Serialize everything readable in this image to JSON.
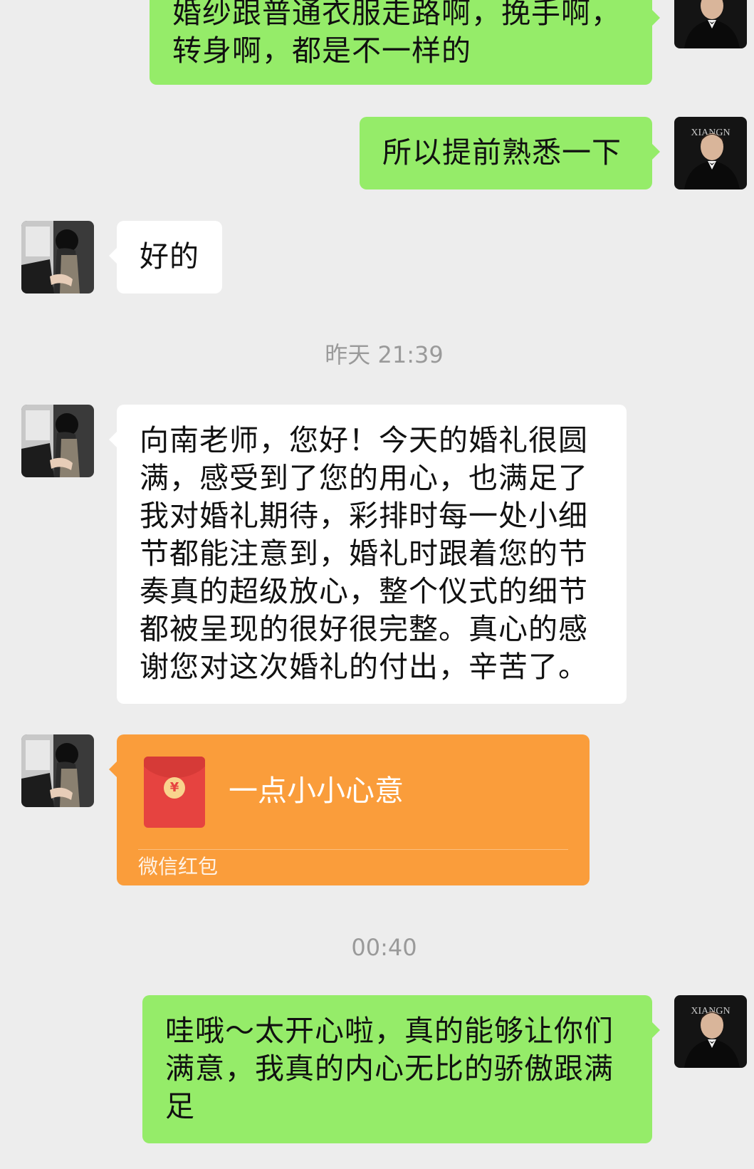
{
  "messages": [
    {
      "sender": "self",
      "text": "婚纱跟普通衣服走路啊，挽手啊，转身啊，都是不一样的"
    },
    {
      "sender": "self",
      "text": "所以提前熟悉一下"
    },
    {
      "sender": "other",
      "text": "好的"
    },
    {
      "sender": "other",
      "text": "向南老师，您好！今天的婚礼很圆满，感受到了您的用心，也满足了我对婚礼期待，彩排时每一处小细节都能注意到，婚礼时跟着您的节奏真的超级放心，整个仪式的细节都被呈现的很好很完整。真心的感谢您对这次婚礼的付出，辛苦了。"
    },
    {
      "sender": "self",
      "text": "哇哦～太开心啦，真的能够让你们满意，我真的内心无比的骄傲跟满足"
    }
  ],
  "timestamps": [
    "昨天 21:39",
    "00:40"
  ],
  "red_packet": {
    "title": "一点小小心意",
    "label": "微信红包",
    "currency_symbol": "¥",
    "icon": "red-envelope-icon"
  },
  "avatar_logo_text": "XIANGN",
  "colors": {
    "background": "#ededed",
    "self_bubble": "#95ec69",
    "other_bubble": "#ffffff",
    "red_packet": "#fa9d3b",
    "timestamp": "#9a9a9a"
  }
}
